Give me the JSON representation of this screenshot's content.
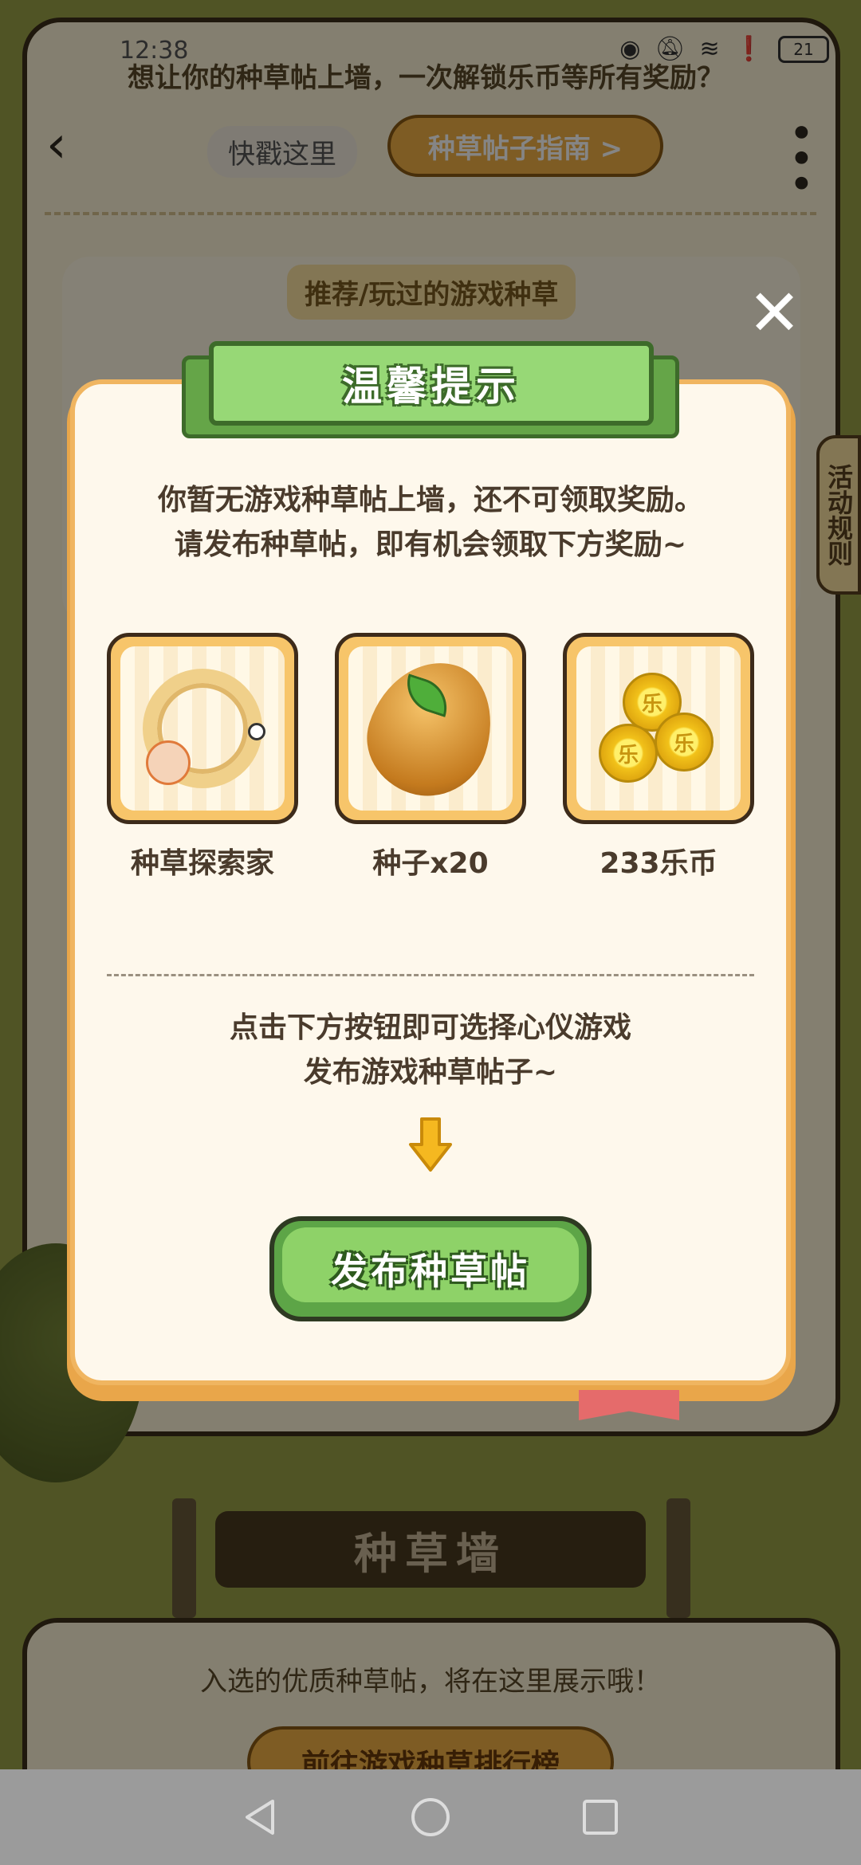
{
  "status_bar": {
    "time": "12:38",
    "battery": "21"
  },
  "background": {
    "top_banner": "想让你的种草帖上墙，一次解锁乐币等所有奖励？",
    "tap_hint": "快戳这里",
    "guide_button": "种草帖子指南 >",
    "recommend_label": "推荐/玩过的游戏种草",
    "side_rules": "活动规则",
    "wall_title": "种草墙",
    "wall_hint": "入选的优质种草帖，将在这里展示哦！",
    "rank_button": "前往游戏种草排行榜"
  },
  "modal": {
    "title": "温馨提示",
    "message_line1": "你暂无游戏种草帖上墙，还不可领取奖励。",
    "message_line2": "请发布种草帖，即有机会领取下方奖励~",
    "rewards": [
      {
        "name": "种草探索家",
        "icon": "wreath-avatar-frame-icon"
      },
      {
        "name": "种子x20",
        "icon": "seed-icon"
      },
      {
        "name": "233乐币",
        "icon": "coins-icon"
      }
    ],
    "instruction_line1": "点击下方按钮即可选择心仪游戏",
    "instruction_line2": "发布游戏种草帖子~",
    "publish_button": "发布种草帖",
    "coin_glyph": "乐"
  },
  "colors": {
    "ribbon_green": "#97d876",
    "button_green": "#8ed268",
    "modal_border": "#f0b560",
    "arrow_yellow": "#f5b820"
  }
}
